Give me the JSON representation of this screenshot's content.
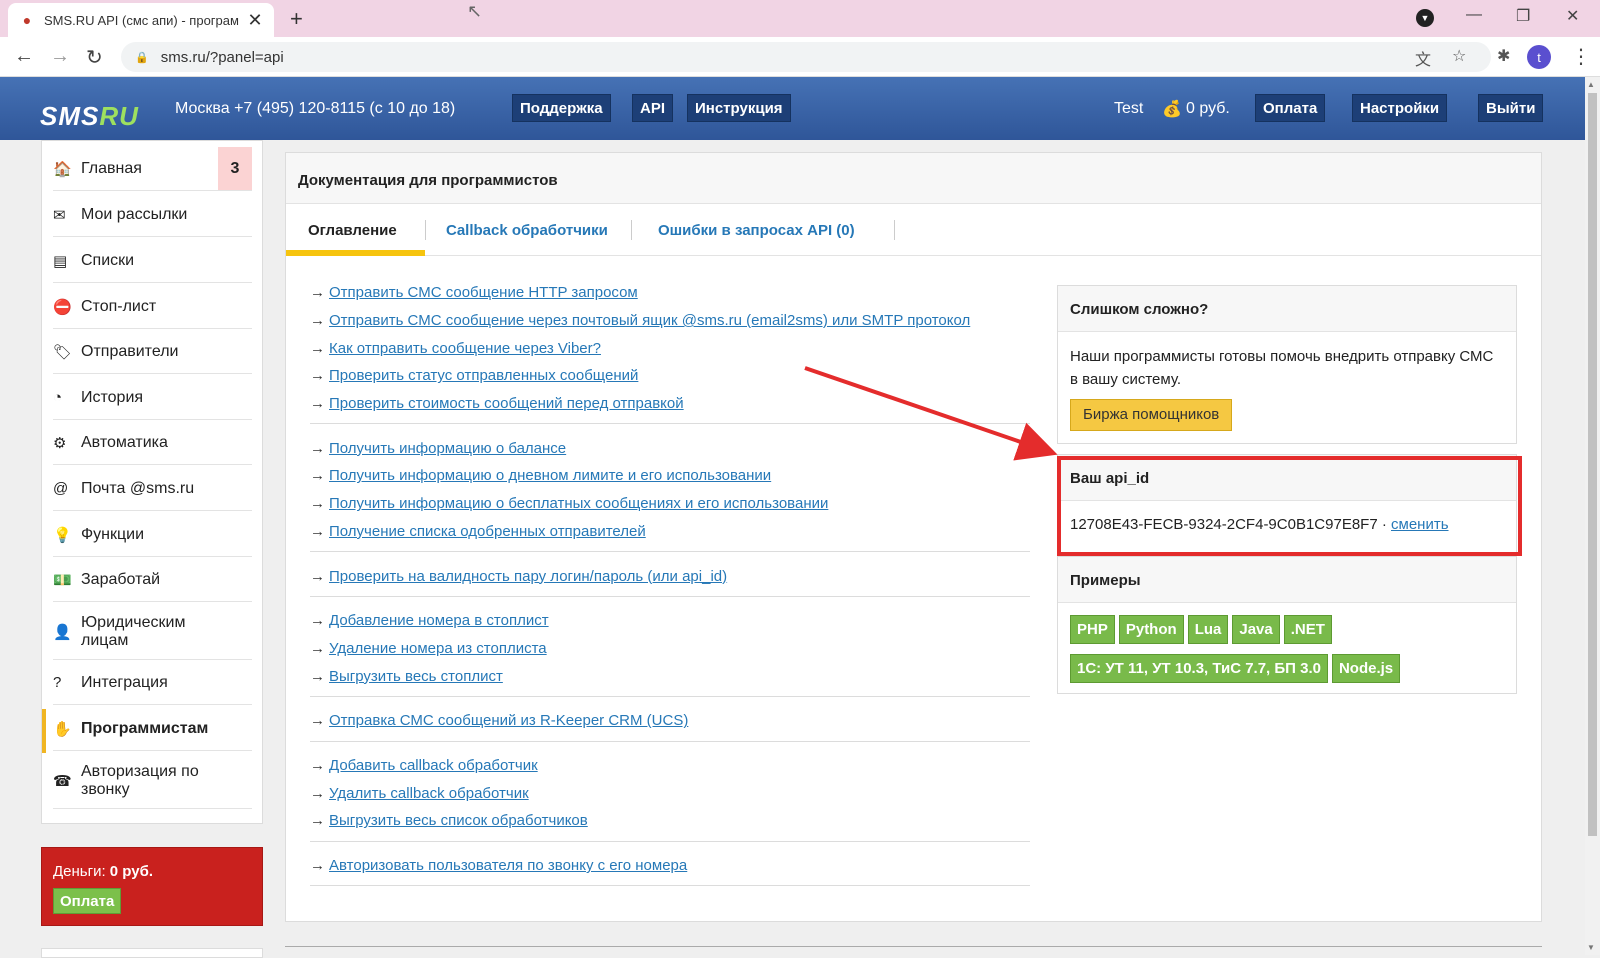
{
  "browser": {
    "tab_title": "SMS.RU API (смс апи) - програм",
    "tab_close": "✕",
    "new_tab": "+",
    "url": "sms.ru/?panel=api",
    "avatar_letter": "t",
    "minimize": "—",
    "restore": "❐",
    "close": "✕"
  },
  "header": {
    "logo_main": "SMS",
    "logo_ru": "RU",
    "city_phone": "Москва  +7 (495) 120-8115 (с 10 до 18)",
    "nav": [
      "Поддержка",
      "API",
      "Инструкция"
    ],
    "user": "Test",
    "balance": "0 руб.",
    "buttons": [
      "Оплата",
      "Настройки",
      "Выйти"
    ]
  },
  "sidebar": {
    "items": [
      {
        "label": "Главная",
        "icon": "home-icon",
        "glyph": "🏠",
        "badge": "3"
      },
      {
        "label": "Мои рассылки",
        "icon": "mailings-icon",
        "glyph": "✉"
      },
      {
        "label": "Списки",
        "icon": "lists-icon",
        "glyph": "▤"
      },
      {
        "label": "Стоп-лист",
        "icon": "stoplist-icon",
        "glyph": "⛔"
      },
      {
        "label": "Отправители",
        "icon": "senders-icon",
        "glyph": "🏷"
      },
      {
        "label": "История",
        "icon": "history-icon",
        "glyph": "◔"
      },
      {
        "label": "Автоматика",
        "icon": "automation-icon",
        "glyph": "⚙"
      },
      {
        "label": "Почта @sms.ru",
        "icon": "at-icon",
        "glyph": "@"
      },
      {
        "label": "Функции",
        "icon": "bulb-icon",
        "glyph": "💡"
      },
      {
        "label": "Заработай",
        "icon": "money-icon",
        "glyph": "💵"
      },
      {
        "label": "Юридическим лицам",
        "icon": "person-icon",
        "glyph": "👤"
      },
      {
        "label": "Интеграция",
        "icon": "help-icon",
        "glyph": "?"
      },
      {
        "label": "Программистам",
        "icon": "hand-icon",
        "glyph": "✋"
      },
      {
        "label": "Авторизация по звонку",
        "icon": "phone-icon",
        "glyph": "☎"
      }
    ],
    "money_label": "Деньги:",
    "money_value": "0 руб.",
    "money_button": "Оплата"
  },
  "main": {
    "title": "Документация для программистов",
    "tabs": [
      "Оглавление",
      "Callback обработчики",
      "Ошибки в запросах API (0)"
    ],
    "link_groups": [
      [
        "Отправить СМС сообщение HTTP запросом",
        "Отправить СМС сообщение через почтовый ящик @sms.ru (email2sms) или SMTP протокол",
        "Как отправить сообщение через Viber?",
        "Проверить статус отправленных сообщений",
        "Проверить стоимость сообщений перед отправкой"
      ],
      [
        "Получить информацию о балансе",
        "Получить информацию о дневном лимите и его использовании",
        "Получить информацию о бесплатных сообщениях и его использовании",
        "Получение списка одобренных отправителей"
      ],
      [
        "Проверить на валидность пару логин/пароль (или api_id)"
      ],
      [
        "Добавление номера в стоплист",
        "Удаление номера из стоплиста",
        "Выгрузить весь стоплист"
      ],
      [
        "Отправка СМС сообщений из R-Keeper CRM (UCS)"
      ],
      [
        "Добавить callback обработчик",
        "Удалить callback обработчик",
        "Выгрузить весь список обработчиков"
      ],
      [
        "Авторизовать пользователя по звонку с его номера"
      ]
    ],
    "arrow": "→"
  },
  "help_box": {
    "title": "Слишком сложно?",
    "text": "Наши программисты готовы помочь внедрить отправку СМС в вашу систему.",
    "button": "Биржа помощников"
  },
  "api_box": {
    "title": "Ваш api_id",
    "api_id": "12708E43-FECB-9324-2CF4-9C0B1C97E8F7 · ",
    "change": "сменить"
  },
  "examples": {
    "title": "Примеры",
    "row1": [
      "PHP",
      "Python",
      "Lua",
      "Java",
      ".NET"
    ],
    "row2": [
      "1С: УТ 11, УТ 10.3, ТиС 7.7, БП 3.0",
      "Node.js"
    ]
  },
  "colors": {
    "header_blue": "#2f5699",
    "link": "#2678b7",
    "accent_yellow": "#f6c40e",
    "annotation_red": "#e42c2c",
    "example_green": "#79ba4a"
  }
}
